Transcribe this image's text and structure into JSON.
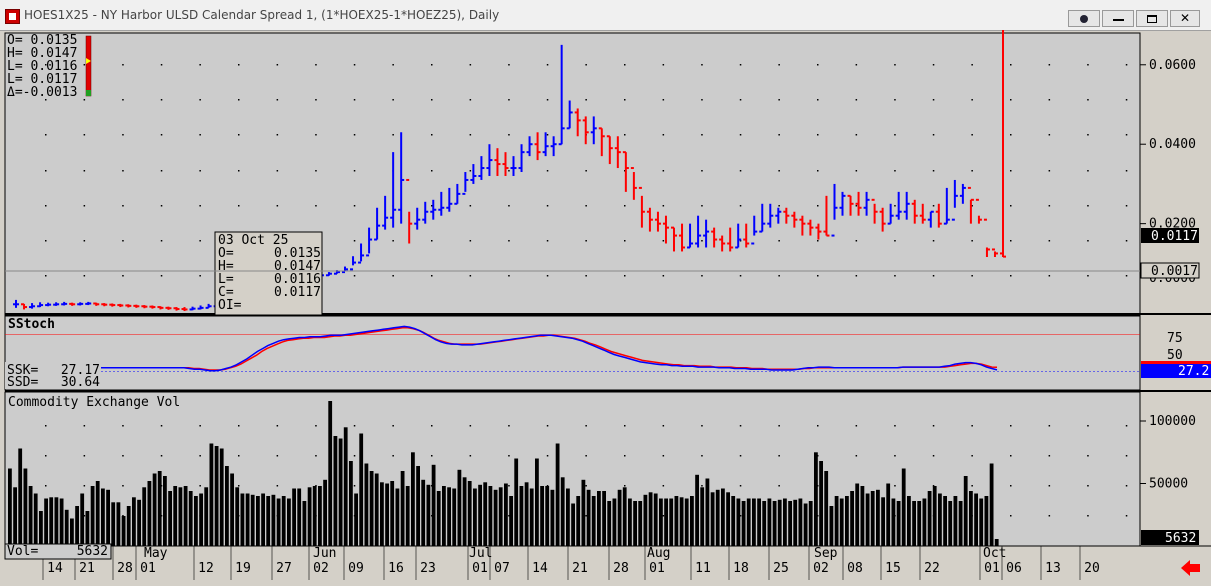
{
  "window": {
    "title": "HOES1X25 - NY Harbor ULSD Calendar Spread 1, (1*HOEX25-1*HOEZ25), Daily",
    "buttons": [
      "dot",
      "minimize",
      "maximize",
      "close"
    ],
    "close_glyph": "✕"
  },
  "ohlc_summary": {
    "open": "O= 0.0135",
    "high": "H= 0.0147",
    "low": "L= 0.0116",
    "low2": "L= 0.0117",
    "delta": "Δ=-0.0013"
  },
  "data_window": {
    "date": "03 Oct 25",
    "rows": [
      {
        "k": "O=",
        "v": "0.0135"
      },
      {
        "k": "H=",
        "v": "0.0147"
      },
      {
        "k": "L=",
        "v": "0.0116"
      },
      {
        "k": "C=",
        "v": "0.0117"
      },
      {
        "k": "OI=",
        "v": ""
      }
    ]
  },
  "price_panel": {
    "last_price_tag": "0.0117",
    "change_tag": "0.0017",
    "hidden_tick": "0.0000"
  },
  "stoch_panel": {
    "title": "SStoch",
    "ssk": {
      "label": "SSK=",
      "value": "27.17"
    },
    "ssd": {
      "label": "SSD=",
      "value": "30.64"
    },
    "value_tag": "27.2",
    "levels": [
      75,
      25
    ],
    "axis_ticks": [
      "75",
      "50"
    ]
  },
  "volume_panel": {
    "title": "Commodity Exchange Vol",
    "vol": {
      "label": "Vol=",
      "value": "5632"
    },
    "value_tag": "5632"
  },
  "x_axis": {
    "day_ticks": [
      "14",
      "21",
      "28",
      "01",
      "12",
      "19",
      "27",
      "02",
      "09",
      "16",
      "23",
      "01",
      "07",
      "14",
      "21",
      "28",
      "01",
      "11",
      "18",
      "25",
      "02",
      "08",
      "15",
      "22",
      "01",
      "06",
      "13",
      "20"
    ],
    "month_labels": [
      "May",
      "Jun",
      "Jul",
      "Aug",
      "Sep",
      "Oct"
    ]
  },
  "colors": {
    "up": "#0000ff",
    "down": "#ff0000",
    "ssk_line": "#0000ff",
    "ssd_line": "#ff0000",
    "panel_bg": "#cccccc",
    "volume": "#000000",
    "nav_arrow": "#ff0000"
  },
  "nav_arrow_icon": "left-arrow-icon",
  "chart_data": [
    {
      "type": "ohlc",
      "ylim": [
        -0.003,
        0.068
      ],
      "yticks": [
        0.06,
        0.04,
        0.02
      ],
      "y_tick_labels": [
        "0.0600",
        "0.0400",
        "0.0200"
      ],
      "x": [
        "04-10",
        "04-11",
        "04-14",
        "04-15",
        "04-16",
        "04-17",
        "04-21",
        "04-22",
        "04-23",
        "04-24",
        "04-25",
        "04-28",
        "04-29",
        "04-30",
        "05-01",
        "05-02",
        "05-05",
        "05-06",
        "05-07",
        "05-08",
        "05-09",
        "05-12",
        "05-13",
        "05-14",
        "05-15",
        "05-16",
        "05-19",
        "05-20",
        "05-21",
        "05-22",
        "05-23",
        "05-27",
        "05-28",
        "05-29",
        "05-30",
        "06-02",
        "06-03",
        "06-04",
        "06-05",
        "06-06",
        "06-09",
        "06-10",
        "06-11",
        "06-12",
        "06-13",
        "06-16",
        "06-17",
        "06-18",
        "06-20",
        "06-23",
        "06-24",
        "06-25",
        "06-26",
        "06-27",
        "06-30",
        "07-01",
        "07-02",
        "07-03",
        "07-07",
        "07-08",
        "07-09",
        "07-10",
        "07-11",
        "07-14",
        "07-15",
        "07-16",
        "07-17",
        "07-18",
        "07-21",
        "07-22",
        "07-23",
        "07-24",
        "07-25",
        "07-28",
        "07-29",
        "07-30",
        "07-31",
        "08-01",
        "08-04",
        "08-05",
        "08-06",
        "08-07",
        "08-08",
        "08-11",
        "08-12",
        "08-13",
        "08-14",
        "08-15",
        "08-18",
        "08-19",
        "08-20",
        "08-21",
        "08-22",
        "08-25",
        "08-26",
        "08-27",
        "08-28",
        "08-29",
        "09-02",
        "09-03",
        "09-04",
        "09-05",
        "09-08",
        "09-09",
        "09-10",
        "09-11",
        "09-12",
        "09-15",
        "09-16",
        "09-17",
        "09-18",
        "09-19",
        "09-22",
        "09-23",
        "09-24",
        "09-25",
        "09-26",
        "09-29",
        "09-30",
        "10-01",
        "10-02",
        "10-03"
      ],
      "close": [
        -0.0003,
        -0.001,
        -0.0008,
        -0.0005,
        -0.0004,
        -0.0003,
        -0.0002,
        -0.0003,
        -0.0002,
        -0.0001,
        -0.0003,
        -0.0004,
        -0.0005,
        -0.0006,
        -0.0007,
        -0.0008,
        -0.0009,
        -0.001,
        -0.0012,
        -0.0013,
        -0.0015,
        -0.0016,
        -0.0014,
        -0.0012,
        -0.0008,
        -0.0002,
        0.0004,
        0.0009,
        0.0014,
        0.002,
        0.0028,
        0.004,
        0.0045,
        0.005,
        0.0055,
        0.006,
        0.0062,
        0.0067,
        0.007,
        0.0074,
        0.0078,
        0.0085,
        0.0102,
        0.012,
        0.016,
        0.0195,
        0.0215,
        0.0235,
        0.031,
        0.02,
        0.021,
        0.023,
        0.0235,
        0.024,
        0.025,
        0.0275,
        0.031,
        0.032,
        0.034,
        0.036,
        0.035,
        0.034,
        0.034,
        0.038,
        0.04,
        0.038,
        0.0395,
        0.04,
        0.044,
        0.048,
        0.046,
        0.043,
        0.044,
        0.042,
        0.039,
        0.038,
        0.034,
        0.029,
        0.023,
        0.021,
        0.02,
        0.019,
        0.017,
        0.014,
        0.015,
        0.017,
        0.018,
        0.016,
        0.015,
        0.014,
        0.016,
        0.015,
        0.018,
        0.02,
        0.022,
        0.023,
        0.022,
        0.021,
        0.02,
        0.019,
        0.018,
        0.017,
        0.024,
        0.027,
        0.025,
        0.024,
        0.026,
        0.023,
        0.02,
        0.022,
        0.023,
        0.025,
        0.022,
        0.021,
        0.023,
        0.02,
        0.021,
        0.027,
        0.029,
        0.026,
        0.021,
        0.0135,
        0.0125,
        0.0117
      ],
      "high": [
        0.0008,
        -0.0002,
        0.0,
        0.0002,
        0.0001,
        0.0002,
        0.0003,
        0.0001,
        0.0002,
        0.0003,
        0.0001,
        0.0,
        -0.0001,
        -0.0002,
        -0.0003,
        -0.0004,
        -0.0005,
        -0.0006,
        -0.0008,
        -0.0009,
        -0.001,
        -0.001,
        -0.0009,
        -0.0006,
        -0.0002,
        0.0004,
        0.001,
        0.0013,
        0.0018,
        0.0025,
        0.0033,
        0.0046,
        0.005,
        0.0055,
        0.006,
        0.0064,
        0.0067,
        0.0071,
        0.0074,
        0.0078,
        0.0083,
        0.0092,
        0.0118,
        0.015,
        0.019,
        0.024,
        0.027,
        0.038,
        0.043,
        0.023,
        0.024,
        0.0255,
        0.026,
        0.028,
        0.029,
        0.03,
        0.033,
        0.035,
        0.037,
        0.04,
        0.039,
        0.038,
        0.037,
        0.04,
        0.042,
        0.043,
        0.043,
        0.042,
        0.065,
        0.051,
        0.049,
        0.047,
        0.047,
        0.044,
        0.042,
        0.042,
        0.038,
        0.033,
        0.027,
        0.024,
        0.023,
        0.022,
        0.019,
        0.02,
        0.02,
        0.022,
        0.021,
        0.019,
        0.017,
        0.019,
        0.02,
        0.02,
        0.022,
        0.025,
        0.025,
        0.024,
        0.024,
        0.023,
        0.022,
        0.021,
        0.02,
        0.027,
        0.03,
        0.028,
        0.027,
        0.028,
        0.028,
        0.025,
        0.024,
        0.025,
        0.028,
        0.028,
        0.026,
        0.025,
        0.023,
        0.025,
        0.029,
        0.031,
        0.03,
        0.026,
        0.022,
        0.014,
        0.013
      ],
      "low": [
        -0.0012,
        -0.0016,
        -0.0014,
        -0.001,
        -0.0008,
        -0.0007,
        -0.0006,
        -0.0007,
        -0.0006,
        -0.0005,
        -0.0007,
        -0.0008,
        -0.0009,
        -0.001,
        -0.0011,
        -0.0012,
        -0.0013,
        -0.0014,
        -0.0016,
        -0.0017,
        -0.0019,
        -0.002,
        -0.0018,
        -0.0016,
        -0.0012,
        -0.0006,
        0.0,
        0.0005,
        0.001,
        0.0015,
        0.0022,
        0.0034,
        0.004,
        0.0045,
        0.0049,
        0.0054,
        0.0057,
        0.0063,
        0.0066,
        0.0069,
        0.0074,
        0.008,
        0.0095,
        0.0105,
        0.0125,
        0.016,
        0.0185,
        0.019,
        0.02,
        0.015,
        0.0185,
        0.02,
        0.021,
        0.022,
        0.023,
        0.025,
        0.028,
        0.03,
        0.031,
        0.032,
        0.032,
        0.032,
        0.032,
        0.033,
        0.037,
        0.036,
        0.037,
        0.037,
        0.04,
        0.044,
        0.042,
        0.04,
        0.04,
        0.037,
        0.035,
        0.034,
        0.028,
        0.026,
        0.019,
        0.018,
        0.018,
        0.015,
        0.013,
        0.013,
        0.014,
        0.014,
        0.014,
        0.014,
        0.013,
        0.013,
        0.014,
        0.014,
        0.017,
        0.018,
        0.019,
        0.02,
        0.02,
        0.019,
        0.017,
        0.017,
        0.016,
        0.017,
        0.021,
        0.022,
        0.022,
        0.022,
        0.022,
        0.02,
        0.018,
        0.02,
        0.021,
        0.021,
        0.02,
        0.02,
        0.019,
        0.019,
        0.02,
        0.024,
        0.025,
        0.02,
        0.02,
        0.0116,
        0.0116,
        0.0116
      ]
    },
    {
      "type": "line",
      "name": "SStoch",
      "ylim": [
        0,
        100
      ],
      "levels": [
        75,
        25
      ],
      "series": [
        {
          "name": "SSK",
          "values": [
            30,
            30,
            30,
            30,
            30,
            30,
            30,
            30,
            30,
            30,
            30,
            30,
            30,
            30,
            30,
            30,
            30,
            29,
            28,
            28,
            27,
            26,
            26,
            27,
            29,
            31,
            34,
            38,
            42,
            47,
            52,
            56,
            60,
            63,
            66,
            68,
            69,
            70,
            71,
            71,
            72,
            72,
            72,
            73,
            74,
            74,
            74,
            75,
            76,
            77,
            78,
            79,
            80,
            81,
            82,
            83,
            84,
            85,
            86,
            85,
            83,
            80,
            76,
            72,
            68,
            65,
            63,
            62,
            62,
            61,
            61,
            61,
            62,
            63,
            64,
            65,
            66,
            67,
            68,
            69,
            70,
            71,
            72,
            73,
            74,
            74,
            74,
            73,
            72,
            71,
            70,
            68,
            66,
            63,
            60,
            57,
            54,
            51,
            48,
            46,
            44,
            42,
            40,
            38,
            37,
            36,
            35,
            34,
            34,
            33,
            33,
            32,
            32,
            32,
            31,
            31,
            31,
            31,
            30,
            30,
            30,
            29,
            29,
            29,
            28,
            28,
            28,
            28,
            27,
            27,
            27,
            27,
            27,
            28,
            29,
            30,
            30,
            31,
            31,
            31,
            30,
            30,
            30,
            30,
            30,
            30,
            30,
            30,
            30,
            30,
            30,
            30,
            30,
            31,
            31,
            31,
            31,
            31,
            31,
            31,
            31,
            32,
            33,
            35,
            36,
            37,
            37,
            36,
            34,
            31,
            29,
            27.17
          ]
        },
        {
          "name": "SSD",
          "values": [
            30,
            30,
            30,
            30,
            30,
            30,
            30,
            30,
            30,
            30,
            30,
            30,
            30,
            30,
            30,
            30,
            30,
            30,
            29,
            29,
            28,
            27,
            27,
            27,
            28,
            30,
            32,
            35,
            39,
            43,
            47,
            52,
            56,
            59,
            62,
            65,
            67,
            68,
            69,
            70,
            70,
            71,
            71,
            71,
            72,
            73,
            73,
            74,
            74,
            75,
            76,
            77,
            78,
            79,
            80,
            81,
            82,
            83,
            84,
            84,
            83,
            81,
            78,
            74,
            70,
            67,
            65,
            63,
            62,
            62,
            62,
            62,
            62,
            62,
            63,
            64,
            65,
            66,
            67,
            68,
            69,
            70,
            71,
            72,
            73,
            73,
            74,
            74,
            73,
            72,
            71,
            70,
            68,
            66,
            63,
            61,
            58,
            55,
            52,
            50,
            48,
            46,
            44,
            42,
            40,
            39,
            38,
            37,
            36,
            35,
            34,
            34,
            33,
            33,
            33,
            32,
            32,
            32,
            31,
            31,
            31,
            31,
            30,
            30,
            30,
            29,
            29,
            29,
            28,
            28,
            28,
            28,
            28,
            28,
            28,
            29,
            29,
            30,
            30,
            30,
            30,
            30,
            30,
            30,
            30,
            30,
            30,
            30,
            30,
            30,
            30,
            30,
            30,
            30,
            31,
            31,
            31,
            31,
            31,
            31,
            31,
            31,
            31,
            32,
            33,
            34,
            35,
            36,
            36,
            35,
            33,
            31,
            30.64
          ]
        }
      ]
    },
    {
      "type": "bar",
      "name": "Commodity Exchange Vol",
      "ylim": [
        0,
        120000
      ],
      "yticks": [
        100000,
        50000
      ],
      "y_tick_labels": [
        "100000",
        "50000"
      ],
      "values": [
        62000,
        47000,
        78000,
        62000,
        48000,
        42000,
        28000,
        38000,
        39000,
        39000,
        38000,
        29000,
        22000,
        32000,
        42000,
        28000,
        48000,
        52000,
        46000,
        45000,
        35000,
        35000,
        24000,
        32000,
        39000,
        37000,
        47000,
        52000,
        58000,
        60000,
        56000,
        44000,
        48000,
        47000,
        48000,
        44000,
        40000,
        42000,
        47000,
        82000,
        80000,
        78000,
        64000,
        58000,
        47000,
        42000,
        42000,
        41000,
        40000,
        42000,
        40000,
        41000,
        38000,
        40000,
        38000,
        46000,
        46000,
        36000,
        47000,
        48000,
        48000,
        53000,
        116000,
        88000,
        86000,
        95000,
        68000,
        42000,
        90000,
        66000,
        60000,
        58000,
        51000,
        50000,
        52000,
        46000,
        60000,
        48000,
        75000,
        64000,
        53000,
        49000,
        65000,
        44000,
        48000,
        47000,
        46000,
        61000,
        55000,
        52000,
        46000,
        49000,
        51000,
        48000,
        45000,
        47000,
        50000,
        40000,
        70000,
        48000,
        51000,
        46000,
        70000,
        48000,
        48000,
        45000,
        82000,
        55000,
        46000,
        34000,
        40000,
        53000,
        45000,
        40000,
        44000,
        44000,
        36000,
        38000,
        45000,
        47000,
        38000,
        36000,
        36000,
        41000,
        43000,
        42000,
        38000,
        38000,
        38000,
        40000,
        39000,
        38000,
        40000,
        57000,
        47000,
        54000,
        43000,
        45000,
        46000,
        43000,
        40000,
        38000,
        36000,
        38000,
        38000,
        38000,
        36000,
        38000,
        36000,
        37000,
        38000,
        36000,
        37000,
        38000,
        34000,
        36000,
        75000,
        68000,
        60000,
        32000,
        40000,
        38000,
        40000,
        44000,
        50000,
        48000,
        42000,
        44000,
        45000,
        39000,
        50000,
        38000,
        36000,
        62000,
        40000,
        36000,
        36000,
        38000,
        44000,
        48000,
        42000,
        40000,
        36000,
        40000,
        36000,
        56000,
        44000,
        42000,
        38000,
        40000,
        66000,
        5632
      ]
    }
  ]
}
